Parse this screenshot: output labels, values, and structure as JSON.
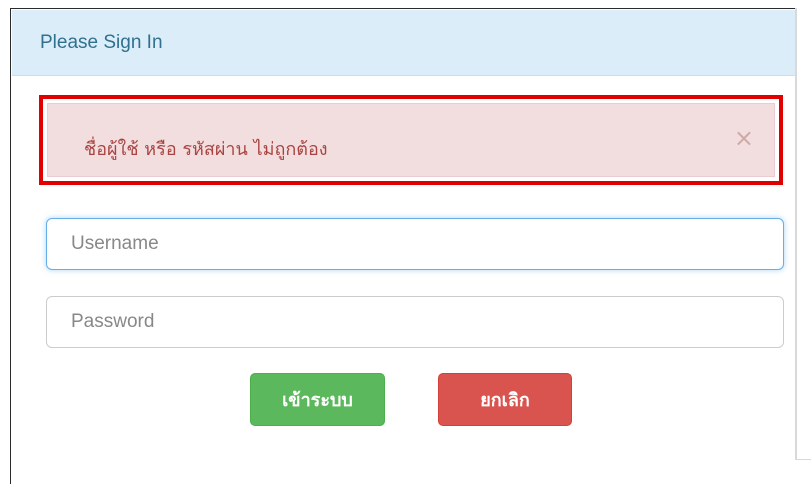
{
  "panel": {
    "title": "Please Sign In"
  },
  "alert": {
    "message": "ชื่อผู้ใช้ หรือ รหัสผ่าน ไม่ถูกต้อง",
    "close_glyph": "×"
  },
  "form": {
    "username_placeholder": "Username",
    "password_placeholder": "Password",
    "login_label": "เข้าระบบ",
    "cancel_label": "ยกเลิก"
  },
  "colors": {
    "heading_bg": "#dbedf8",
    "alert_bg": "#f2dede",
    "alert_text": "#a94442",
    "highlight_border": "#e00000",
    "login_button": "#5cb85c",
    "cancel_button": "#d9534f"
  }
}
